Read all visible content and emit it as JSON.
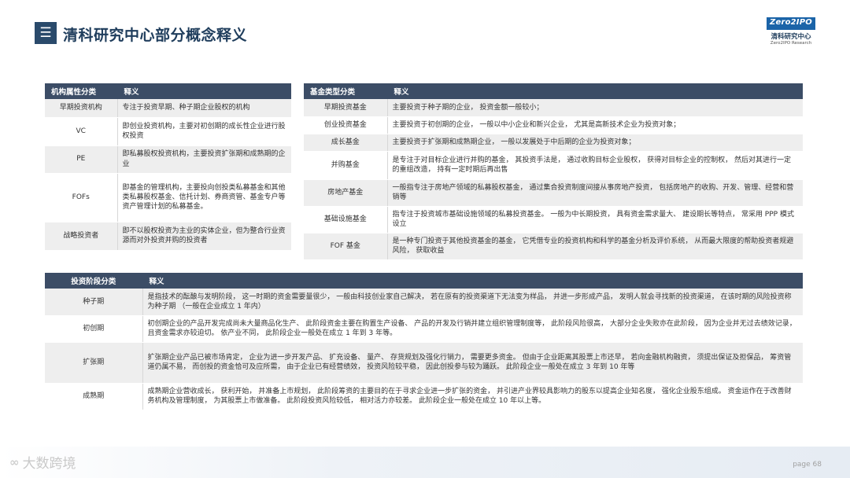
{
  "header": {
    "menu_icon": "menu-icon",
    "title": "清科研究中心部分概念释义",
    "logo": {
      "mark": "Zero2IPO",
      "cn": "清科研究中心",
      "en": "Zero2IPO Research"
    }
  },
  "table_institution": {
    "headers": [
      "机构属性分类",
      "释义"
    ],
    "rows": [
      [
        "早期投资机构",
        "专注于投资早期、种子期企业股权的机构"
      ],
      [
        "VC",
        "即创业投资机构，主要对初创期的成长性企业进行股权投资"
      ],
      [
        "PE",
        "即私募股权投资机构，主要投资扩张期和成熟期的企业"
      ],
      [
        "FOFs",
        "即基金的管理机构，主要投向创投类私募基金和其他类私募股权基金、信托计划、券商资管、基金专户等资产管理计划的私募基金。"
      ],
      [
        "战略投资者",
        "即不以股权投资为主业的实体企业，但为整合行业资源而对外投资并购的投资者"
      ]
    ]
  },
  "table_fund": {
    "headers": [
      "基金类型分类",
      "释义"
    ],
    "rows": [
      [
        "早期投资基金",
        "主要投资于种子期的企业， 投资金额一般较小；"
      ],
      [
        "创业投资基金",
        "主要投资于初创期的企业， 一般以中小企业和新兴企业， 尤其是高新技术企业为投资对象；"
      ],
      [
        "成长基金",
        "主要投资于扩张期和成熟期企业， 一般以发展处于中后期的企业为投资对象；"
      ],
      [
        "并购基金",
        "是专注于对目标企业进行并购的基金， 其投资手法是， 通过收购目标企业股权， 获得对目标企业的控制权， 然后对其进行一定的重组改造， 持有一定时期后再出售"
      ],
      [
        "房地产基金",
        "一般指专注于房地产领域的私募股权基金， 通过集合投资制度间接从事房地产投资， 包括房地产的收购、开发、管理、经营和营销等"
      ],
      [
        "基础设施基金",
        "指专注于投资城市基础设施领域的私募投资基金。 一般为中长期投资， 具有资金需求量大、 建设期长等特点， 常采用 PPP 模式设立"
      ],
      [
        "FOF 基金",
        "是一种专门投资于其他投资基金的基金， 它凭借专业的投资机构和科学的基金分析及评价系统， 从而最大限度的帮助投资者规避风险， 获取收益"
      ]
    ]
  },
  "table_stage": {
    "headers": [
      "投资阶段分类",
      "释义"
    ],
    "rows": [
      [
        "种子期",
        "是指技术的酝酿与发明阶段， 这一时期的资金需要量很少， 一般由科技创业家自己解决， 若在原有的投资渠道下无法变为样品， 并进一步形成产品， 发明人就会寻找新的投资渠道， 在该时期的风险投资称为种子期 （一般在企业成立 1 年内）"
      ],
      [
        "初创期",
        "初创期企业的产品开发完成尚未大量商品化生产、 此阶段资金主要在购置生产设备、 产品的开发及行销并建立组织管理制度等， 此阶段风险很高， 大部分企业失败亦在此阶段， 因为企业并无过去绩效记录， 且资金需求亦较迫切。 依产业不同， 此阶段企业一般处在成立 1 年到 3 年等。"
      ],
      [
        "扩张期",
        "扩张期企业产品已被市场肯定， 企业为进一步开发产品、 扩充设备、 量产、 存货规划及强化行销力， 需要更多资金。 但由于企业距离其股票上市还早， 若向金融机构融资， 须提出保证及担保品， 筹资管道仍属不易， 而创投的资金恰可及应所需， 由于企业已有经营绩效， 投资风险较平稳， 因此创投参与较为踊跃。 此阶段企业一般处在成立 3 年到 10 年等"
      ],
      [
        "成熟期",
        "成熟期企业营收成长， 获利开始， 并准备上市规划， 此阶段筹资的主要目的在于寻求企业进一步扩张的资金， 并引进产业界较具影响力的股东以提高企业知名度， 强化企业股东组成。 资金运作在于改善财务机构及管理制度， 为其股票上市做准备。 此阶段投资风险较低， 相对活力亦较差。 此阶段企业一般处在成立 10 年以上等。"
      ]
    ]
  },
  "footer": {
    "watermark": "大数跨境",
    "page_label": "page",
    "page_number": "68"
  }
}
